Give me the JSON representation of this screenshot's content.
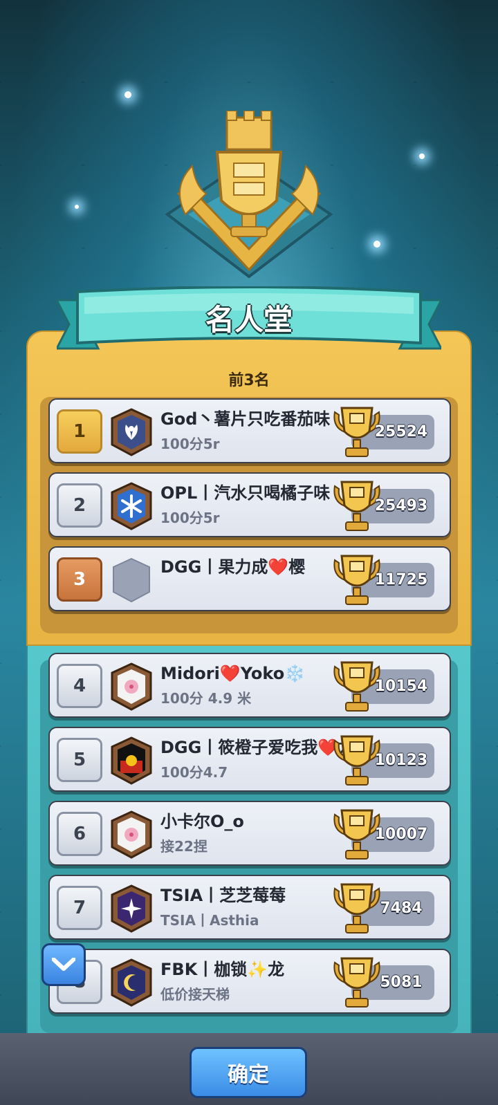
{
  "title": "名人堂",
  "subtitle": "前3名",
  "top_rows": [
    {
      "rank": "1",
      "name": "God丶薯片只吃番茄味",
      "sub": "100分5r",
      "trophies": "25524",
      "rank_style": "gold",
      "badge_icon": "lotus-icon"
    },
    {
      "rank": "2",
      "name": "OPL丨汽水只喝橘子味",
      "sub": "100分5r",
      "trophies": "25493",
      "rank_style": "silver",
      "badge_icon": "snowflake-icon"
    },
    {
      "rank": "3",
      "name": "DGG丨果力成❤️樱",
      "sub": "",
      "trophies": "11725",
      "rank_style": "bronze",
      "badge_icon": "empty-shield-icon"
    }
  ],
  "rows": [
    {
      "rank": "4",
      "name": "Midori❤️Yoko❄️",
      "sub": "100分 4.9 米",
      "trophies": "10154",
      "rank_style": "silver",
      "badge_icon": "cherry-blossom-icon"
    },
    {
      "rank": "5",
      "name": "DGG丨筱橙子爱吃我❤️龙",
      "sub": "100分4.7",
      "trophies": "10123",
      "rank_style": "silver",
      "badge_icon": "aboriginal-flag-icon"
    },
    {
      "rank": "6",
      "name": "小卡尔O_o",
      "sub": "接22捏",
      "trophies": "10007",
      "rank_style": "silver",
      "badge_icon": "cherry-blossom-icon"
    },
    {
      "rank": "7",
      "name": "TSIA丨芝芝莓莓",
      "sub": "TSIA丨Asthia",
      "trophies": "7484",
      "rank_style": "silver",
      "badge_icon": "star-burst-icon"
    },
    {
      "rank": "8",
      "name": "FBK丨枷锁✨龙",
      "sub": "低价接天梯",
      "trophies": "5081",
      "rank_style": "silver",
      "badge_icon": "crescent-moon-icon"
    }
  ],
  "ok_button": "确定",
  "colors": {
    "gold_panel": "#f3c657",
    "teal_panel": "#56c8cc",
    "button_blue": "#3a8ce6"
  }
}
